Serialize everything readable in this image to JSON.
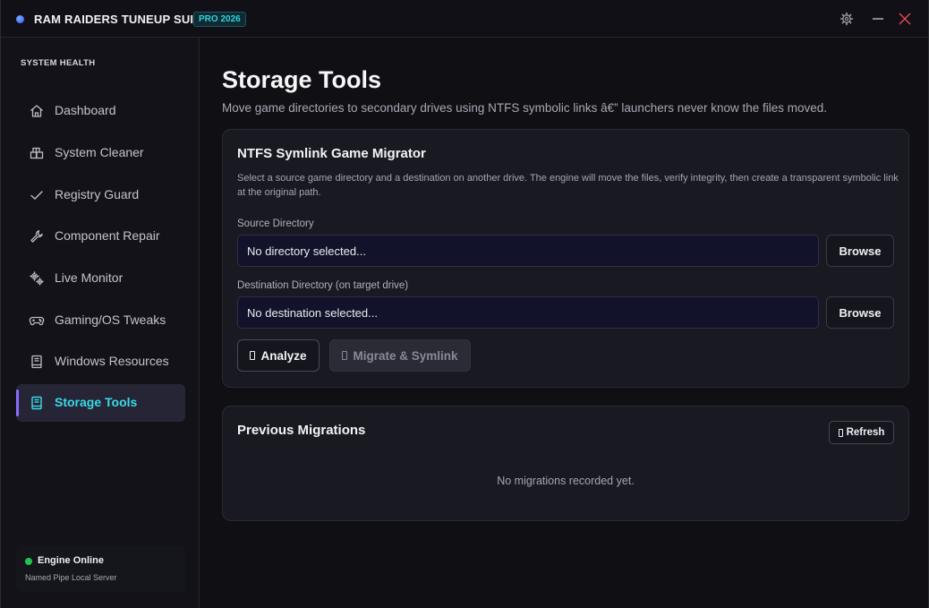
{
  "window": {
    "title": "RAM RAIDERS TUNEUP SUITE",
    "badge": "PRO 2026",
    "icons": [
      "settings-gear-icon",
      "minimize-icon",
      "close-icon"
    ],
    "accent": "#3ad9e8",
    "close_color": "#e5484d"
  },
  "sidebar": {
    "heading": "SYSTEM HEALTH",
    "items": [
      {
        "label": "Dashboard",
        "icon": "home-icon"
      },
      {
        "label": "System Cleaner",
        "icon": "cleaner-icon"
      },
      {
        "label": "Registry Guard",
        "icon": "checkmark-icon"
      },
      {
        "label": "Component Repair",
        "icon": "wrench-icon"
      },
      {
        "label": "Live Monitor",
        "icon": "gears-icon"
      },
      {
        "label": "Gaming/OS Tweaks",
        "icon": "gamepad-icon"
      },
      {
        "label": "Windows Resources",
        "icon": "book-icon"
      },
      {
        "label": "Storage Tools",
        "icon": "storage-icon",
        "active": true
      }
    ],
    "engine": {
      "status": "Engine Online",
      "detail": "Named Pipe Local Server",
      "status_color": "#1fc44f"
    }
  },
  "main": {
    "title": "Storage Tools",
    "subtitle": "Move game directories to secondary drives using NTFS symbolic links â€” launchers never know the files moved.",
    "migrator": {
      "title": "NTFS Symlink Game Migrator",
      "description": "Select a source game directory and a destination on another drive. The engine will move the files, verify integrity, then create a transparent symbolic link at the original path.",
      "source": {
        "label": "Source Directory",
        "placeholder": "No directory selected...",
        "browse_label": "Browse"
      },
      "destination": {
        "label": "Destination Directory (on target drive)",
        "placeholder": "No destination selected...",
        "browse_label": "Browse"
      },
      "analyze_label": "Analyze",
      "migrate_label": "Migrate & Symlink"
    },
    "previous": {
      "title": "Previous Migrations",
      "refresh_label": "Refresh",
      "empty_text": "No migrations recorded yet."
    }
  }
}
